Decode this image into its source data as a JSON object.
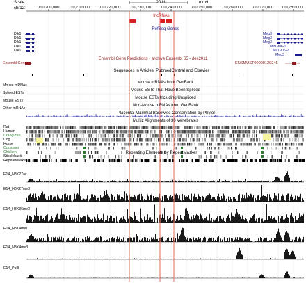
{
  "ruler": {
    "scale_label": "Scale",
    "chrom_label": "chr12:",
    "scale_bar_text": "20 kb",
    "assembly": "mm9",
    "positions": [
      "110,700,000",
      "110,710,000",
      "110,720,000",
      "110,730,000",
      "110,740,000",
      "110,750,000",
      "110,760,000",
      "110,770,000",
      "110,780,000"
    ]
  },
  "tracks": {
    "lncrnas_title": "lncRNAs",
    "refseq_title": "RefSeq Genes",
    "dlk1_labels": [
      "Dlk1",
      "Dlk1",
      "Dlk1",
      "Dlk1",
      "Dlk1"
    ],
    "meg3_labels": [
      "Meg3",
      "Meg3",
      "Meg3",
      "Mir1906-1",
      "Mir1906-2",
      "Meg3"
    ],
    "ensembl_title": "Ensembl Gene Predictions - archive Ensembl 65 - dec2011",
    "ensembl_left_label": "Ensembl Genes",
    "ensembl_id": "ENSMUST00000129245",
    "pubmed_title": "Sequences in Articles: PubmedCentral and Elsevier",
    "mrna_title": "Mouse mRNAs from GenBank",
    "spliced_title": "Mouse ESTs That Have Been Spliced",
    "est_title": "Mouse ESTs Including Unspliced",
    "nonmouse_title": "Non-Mouse mRNAs from GenBank",
    "left_mrna": "Mouse mRNAs",
    "left_spliced": "Spliced ESTs",
    "left_est": "Mouse ESTs",
    "left_other": "Other mRNAs",
    "phylop_title": "Placental Mammal Basewise Conservation by PhyloP",
    "multiz_title": "Multiz Alignments of 30 Vertebrates",
    "species": [
      "Rat",
      "Human",
      "Orangutan",
      "Dog",
      "Horse",
      "Opossum",
      "Chicken",
      "Stickleback"
    ],
    "species_colors": [
      "#000000",
      "#000000",
      "#2e7d32",
      "#000000",
      "#000000",
      "#2e7d32",
      "#2e7d32",
      "#000000"
    ],
    "repeat_title": "Repeating Elements by RepeatMasker",
    "repeat_left": "RepeatMasker",
    "chip_tracks": [
      "E14_H3K27ac",
      "E14_H3K27me3",
      "E14_H3K36me3",
      "E14_H3K4me1",
      "E14_H3K4me3",
      "E14_PolII"
    ]
  },
  "colors": {
    "highlight": "#e8736b",
    "lncrna": "#d62020",
    "refseq": "#1a1a8c",
    "ensembl": "#8b1a1a",
    "conservation": "#4040b0"
  }
}
